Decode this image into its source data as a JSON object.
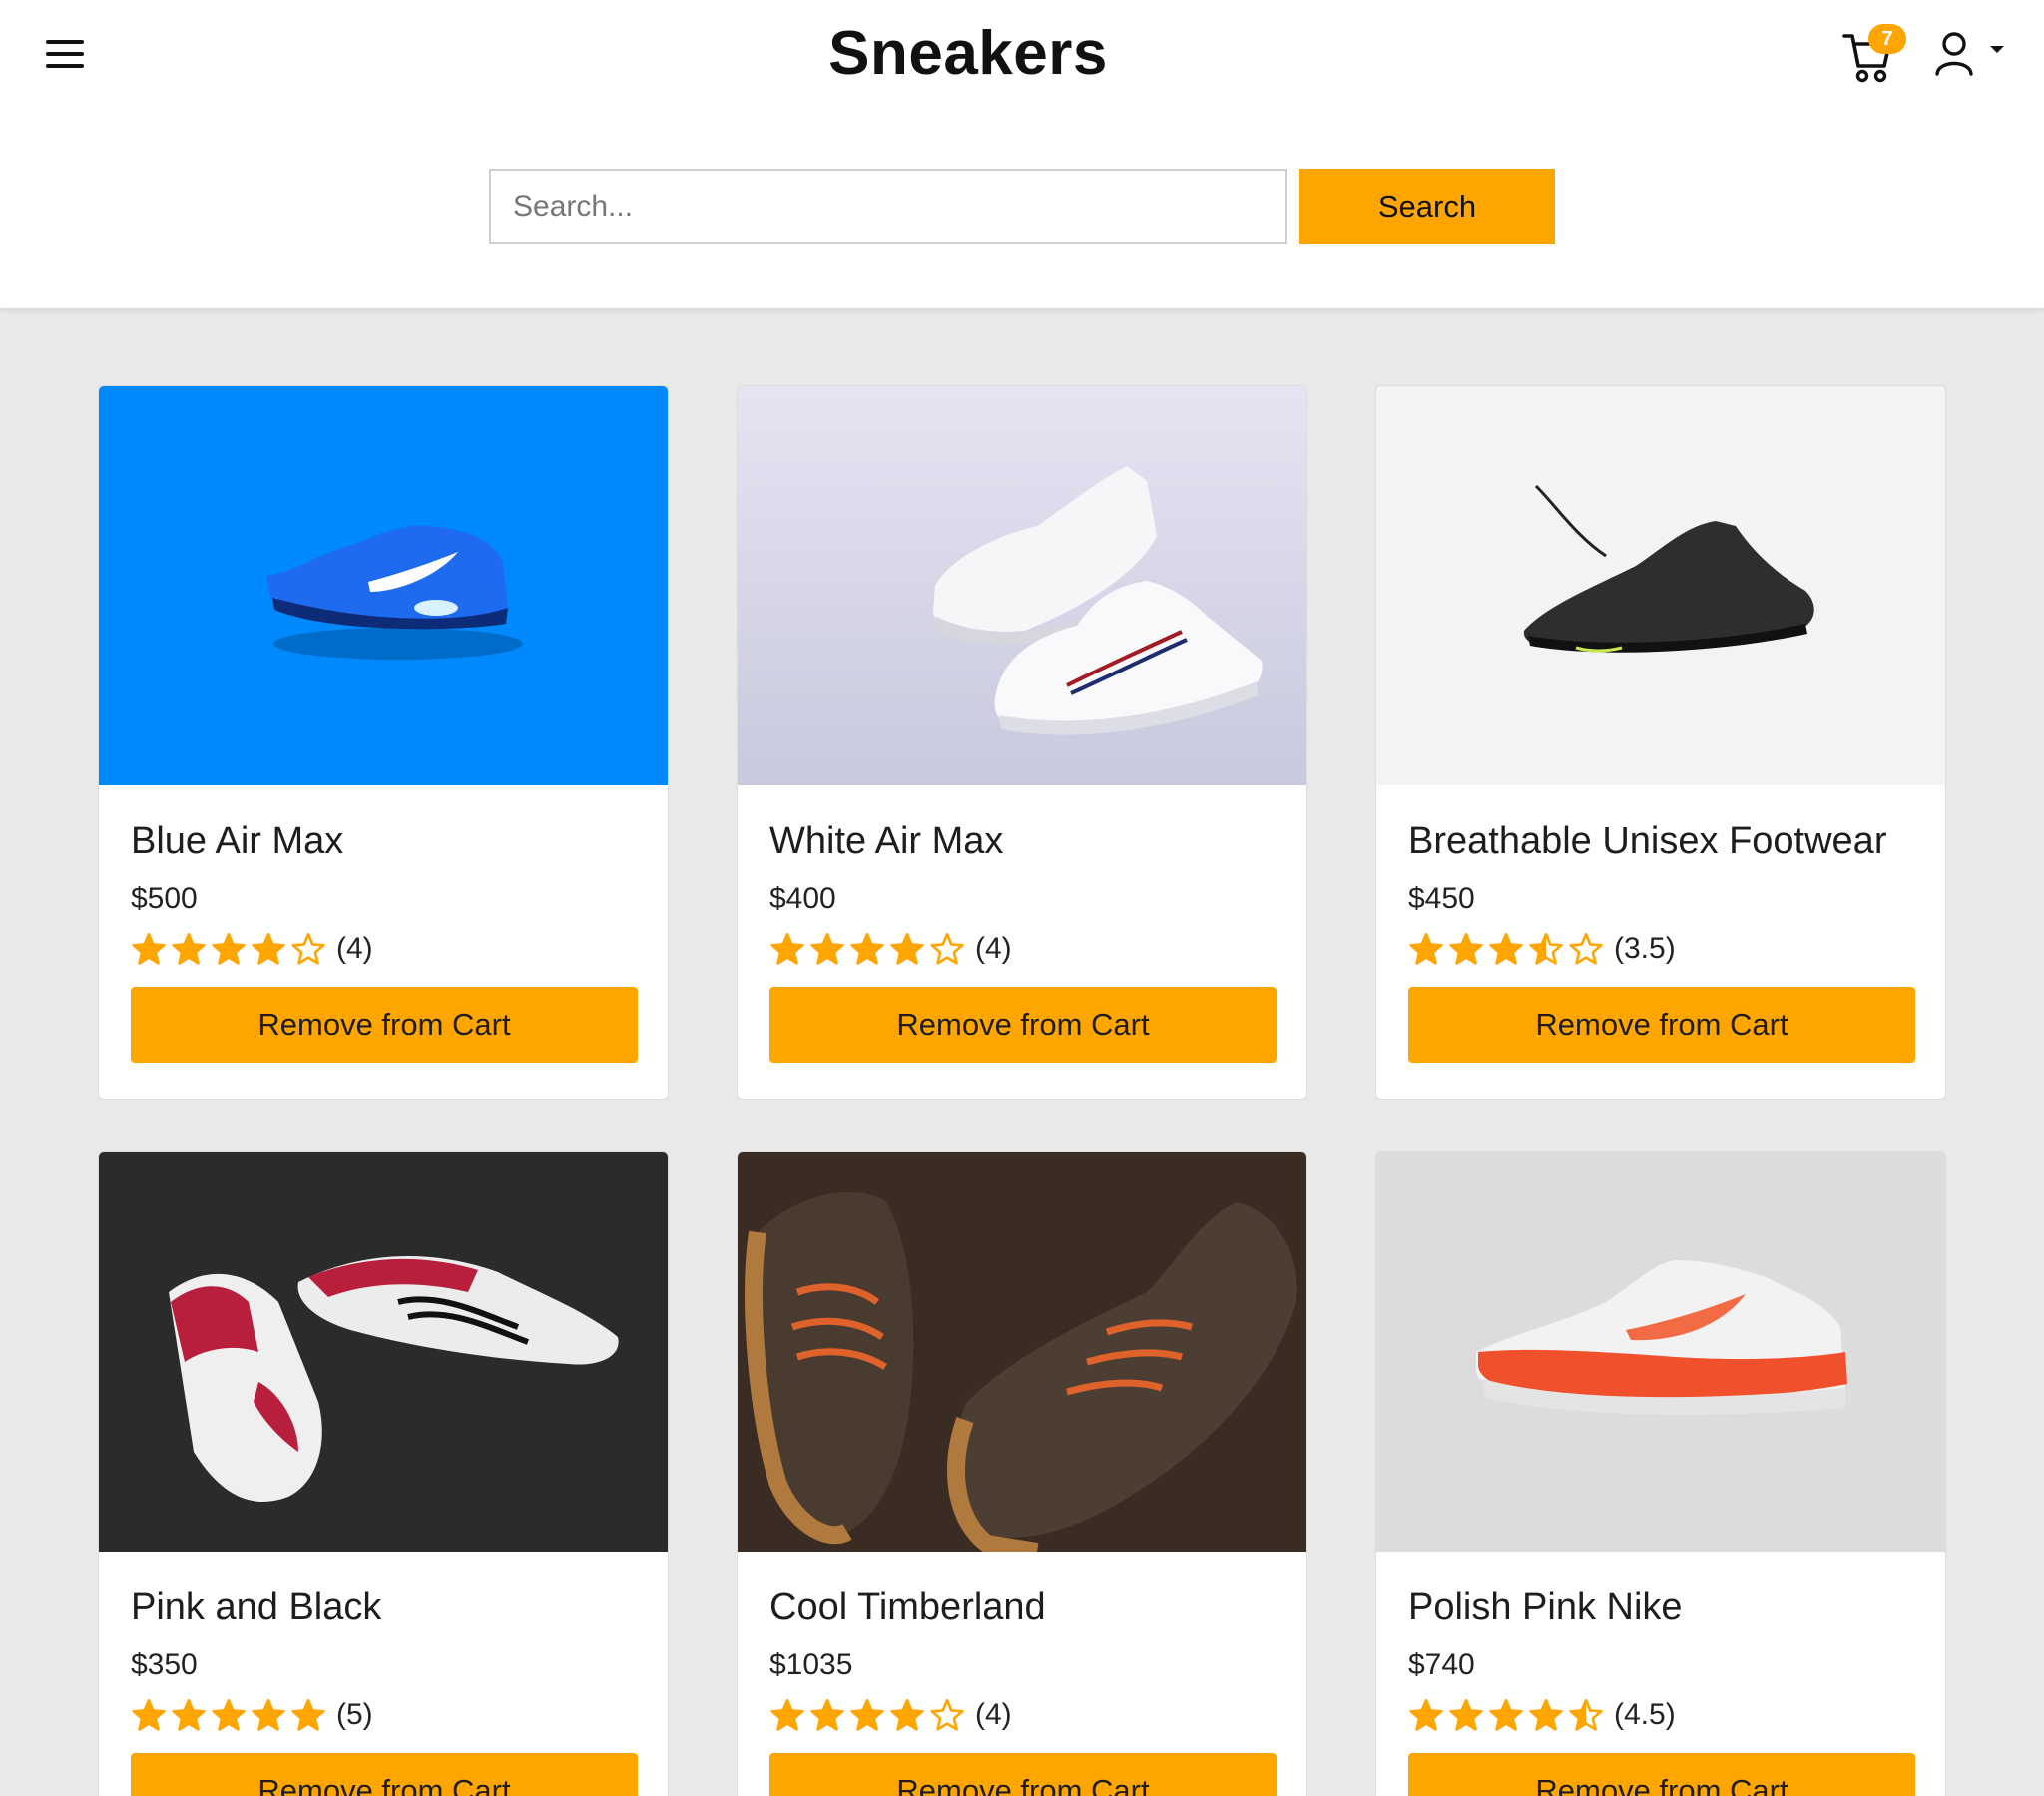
{
  "app": {
    "brand": "Sneakers",
    "cart_count": "7"
  },
  "search": {
    "placeholder": "Search...",
    "button_label": "Search"
  },
  "colors": {
    "accent": "#ffa500",
    "star": "#ffa500",
    "page_background": "#e9e9e9"
  },
  "icons": {
    "menu": "hamburger-menu-icon",
    "cart": "shopping-cart-icon",
    "user": "user-account-icon",
    "star_full": "star-full-icon",
    "star_half": "star-half-icon",
    "star_empty": "star-empty-icon"
  },
  "products": [
    {
      "name": "Blue Air Max",
      "price": "$500",
      "rating": 4,
      "rating_label": "(4)",
      "action_label": "Remove from Cart"
    },
    {
      "name": "White Air Max",
      "price": "$400",
      "rating": 4,
      "rating_label": "(4)",
      "action_label": "Remove from Cart"
    },
    {
      "name": "Breathable Unisex Footwear",
      "price": "$450",
      "rating": 3.5,
      "rating_label": "(3.5)",
      "action_label": "Remove from Cart"
    },
    {
      "name": "Pink and Black",
      "price": "$350",
      "rating": 5,
      "rating_label": "(5)",
      "action_label": "Remove from Cart"
    },
    {
      "name": "Cool Timberland",
      "price": "$1035",
      "rating": 4,
      "rating_label": "(4)",
      "action_label": "Remove from Cart"
    },
    {
      "name": "Polish Pink Nike",
      "price": "$740",
      "rating": 4.5,
      "rating_label": "(4.5)",
      "action_label": "Remove from Cart"
    }
  ]
}
